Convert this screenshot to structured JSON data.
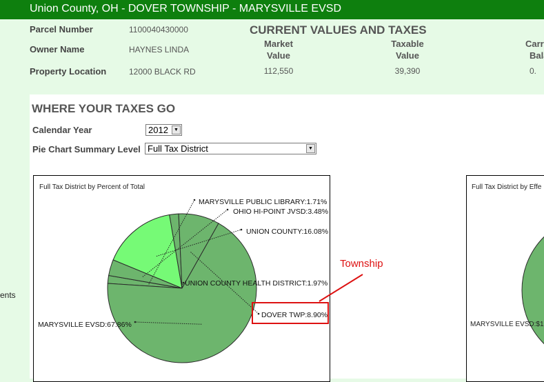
{
  "header": {
    "title": "Union County, OH - DOVER TOWNSHIP - MARYSVILLE EVSD"
  },
  "parcel": {
    "parcel_number_label": "Parcel Number",
    "parcel_number": "1100040430000",
    "owner_label": "Owner Name",
    "owner": "HAYNES LINDA",
    "location_label": "Property Location",
    "location": "12000 BLACK RD"
  },
  "current_values": {
    "title": "CURRENT VALUES AND TAXES",
    "market_value_label": [
      "Market",
      "Value"
    ],
    "market_value": "112,550",
    "taxable_value_label": [
      "Taxable",
      "Value"
    ],
    "taxable_value": "39,390",
    "carry_balance_label": [
      "Carry",
      "Bala"
    ],
    "carry_balance": "0."
  },
  "taxes": {
    "title": "WHERE YOUR TAXES GO",
    "year_label": "Calendar Year",
    "year_value": "2012",
    "summary_label": "Pie Chart Summary Level",
    "summary_value": "Full Tax District"
  },
  "side_text": "ents",
  "annotation": {
    "label": "Township",
    "color": "#dd1111"
  },
  "chart2": {
    "title": "Full Tax District by Effe",
    "visible_label": "MARYSVILLE EVSD:$1"
  },
  "chart_data": {
    "type": "pie",
    "title": "Full Tax District by Percent of Total",
    "slices": [
      {
        "label": "MARYSVILLE PUBLIC LIBRARY",
        "value": 1.71,
        "text": "MARYSVILLE PUBLIC LIBRARY:1.71%"
      },
      {
        "label": "OHIO HI-POINT JVSD",
        "value": 3.48,
        "text": "OHIO HI-POINT JVSD:3.48%"
      },
      {
        "label": "UNION COUNTY",
        "value": 16.08,
        "text": "UNION COUNTY:16.08%"
      },
      {
        "label": "UNION COUNTY HEALTH DISTRICT",
        "value": 1.97,
        "text": "UNION COUNTY HEALTH DISTRICT:1.97%"
      },
      {
        "label": "DOVER TWP",
        "value": 8.9,
        "text": "DOVER TWP:8.90%"
      },
      {
        "label": "MARYSVILLE EVSD",
        "value": 67.86,
        "text": "MARYSVILLE EVSD:67.86%"
      }
    ],
    "colors": {
      "main": "#6db56d",
      "highlight": "#76fa76",
      "stroke": "#2a2a2a"
    }
  }
}
